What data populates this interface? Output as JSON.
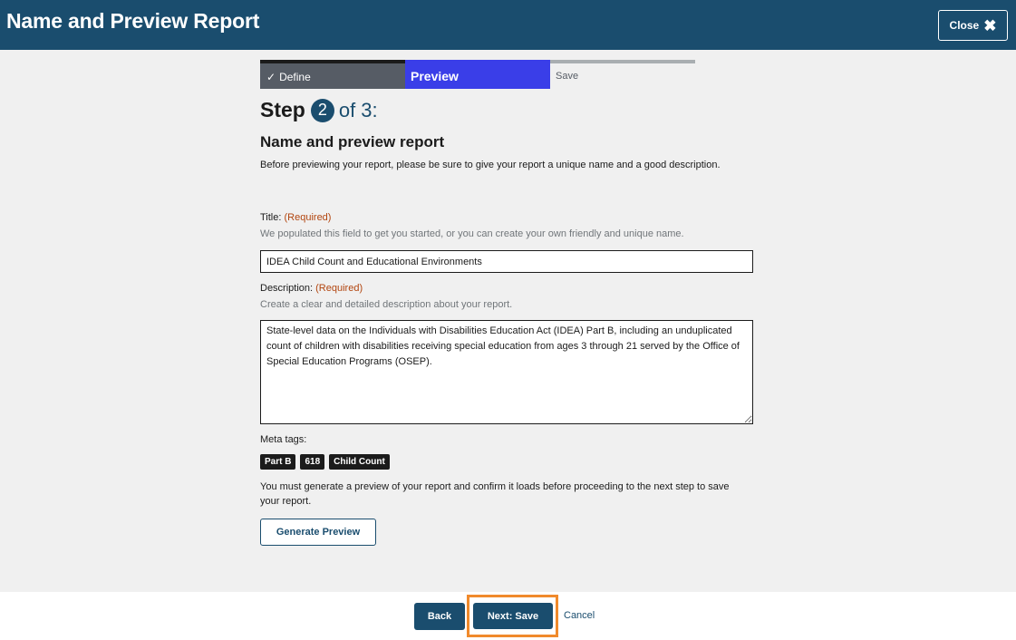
{
  "header": {
    "title": "Name and Preview Report",
    "close_label": "Close",
    "close_icon": "close-x-icon"
  },
  "stepper": {
    "steps": [
      {
        "label": "Define",
        "state": "complete",
        "icon": "check-icon"
      },
      {
        "label": "Preview",
        "state": "current"
      },
      {
        "label": "Save",
        "state": "upcoming"
      }
    ]
  },
  "step_heading": {
    "word": "Step",
    "current": "2",
    "of_text": "of 3:"
  },
  "form": {
    "heading": "Name and preview report",
    "intro": "Before previewing your report, please be sure to give your report a unique name and a good description.",
    "title_label": "Title:",
    "title_required": "(Required)",
    "title_hint": "We populated this field to get you started, or you can create your own friendly and unique name.",
    "title_value": "IDEA Child Count and Educational Environments",
    "description_label": "Description:",
    "description_required": "(Required)",
    "description_hint": "Create a clear and detailed description about your report.",
    "description_value": "State-level data on the Individuals with Disabilities Education Act (IDEA) Part B, including an unduplicated count of children with disabilities receiving special education from ages 3 through 21 served by the Office of Special Education Programs (OSEP).",
    "meta_label": "Meta tags:",
    "tags": [
      "Part B",
      "618",
      "Child Count"
    ],
    "notice": "You must generate a preview of your report and confirm it loads before proceeding to the next step to save your report.",
    "generate_label": "Generate Preview"
  },
  "footer": {
    "back_label": "Back",
    "next_label": "Next: Save",
    "cancel_label": "Cancel"
  },
  "colors": {
    "header_bg": "#1a4d6e",
    "current_step": "#3a3ee8",
    "required": "#b2450f",
    "highlight": "#f08a2c"
  }
}
